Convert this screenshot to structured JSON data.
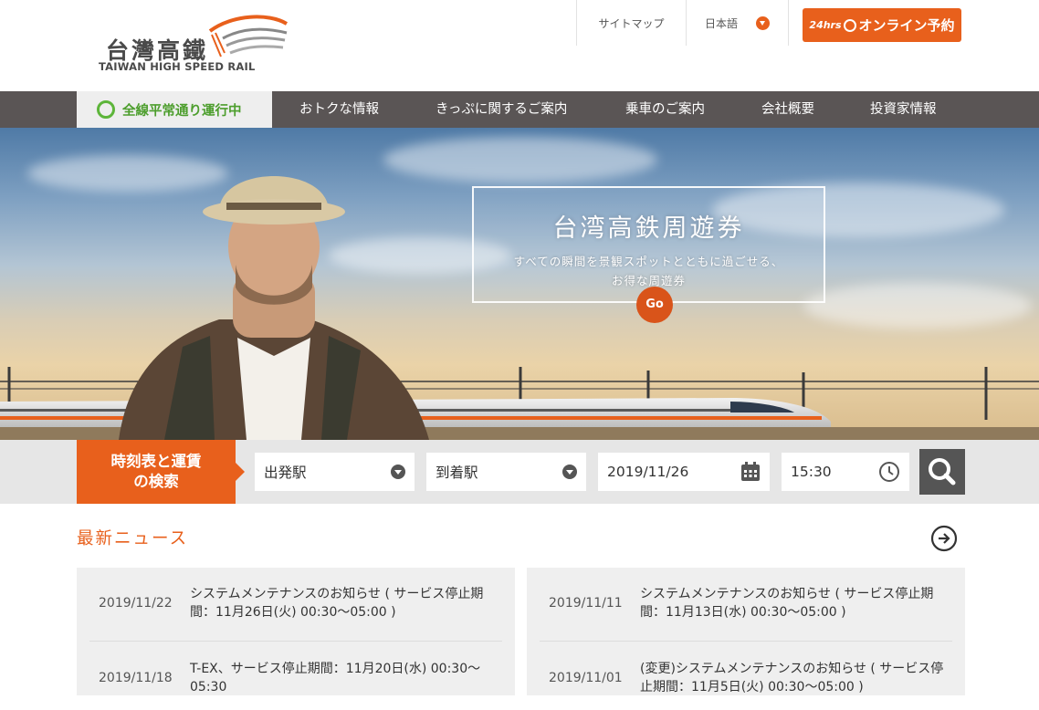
{
  "brand": {
    "name_cn": "台灣高鐵",
    "name_en": "TAIWAN HIGH SPEED RAIL"
  },
  "header": {
    "sitemap": "サイトマップ",
    "language": "日本語",
    "booking": {
      "prefix": "24hrs",
      "label": "オンライン予約"
    }
  },
  "nav": {
    "status": "全線平常通り運行中",
    "items": [
      "おトクな情報",
      "きっぷに関するご案内",
      "乗車のご案内",
      "会社概要",
      "投資家情報"
    ]
  },
  "hero": {
    "title": "台湾高鉄周遊券",
    "subtitle_line1": "すべての瞬間を景観スポットとともに過ごせる、",
    "subtitle_line2": "お得な周遊券",
    "go": "Go"
  },
  "search": {
    "title_line1": "時刻表と運賃",
    "title_line2": "の検索",
    "departure": "出発駅",
    "arrival": "到着駅",
    "date": "2019/11/26",
    "time": "15:30"
  },
  "news": {
    "heading": "最新ニュース",
    "left": [
      {
        "date": "2019/11/22",
        "text": "システムメンテナンスのお知らせ ( サービス停止期間：11月26日(火) 00:30～05:00 )"
      },
      {
        "date": "2019/11/18",
        "text": "T-EX、サービス停止期間：11月20日(水) 00:30～05:30"
      }
    ],
    "right": [
      {
        "date": "2019/11/11",
        "text": "システムメンテナンスのお知らせ ( サービス停止期間：11月13日(水) 00:30～05:00 )"
      },
      {
        "date": "2019/11/01",
        "text": "(変更)システムメンテナンスのお知らせ ( サービス停止期間：11月5日(火) 00:30～05:00 )"
      }
    ]
  },
  "colors": {
    "accent": "#e8601c",
    "nav_bg": "#5a5555",
    "status_green": "#5db53a"
  }
}
